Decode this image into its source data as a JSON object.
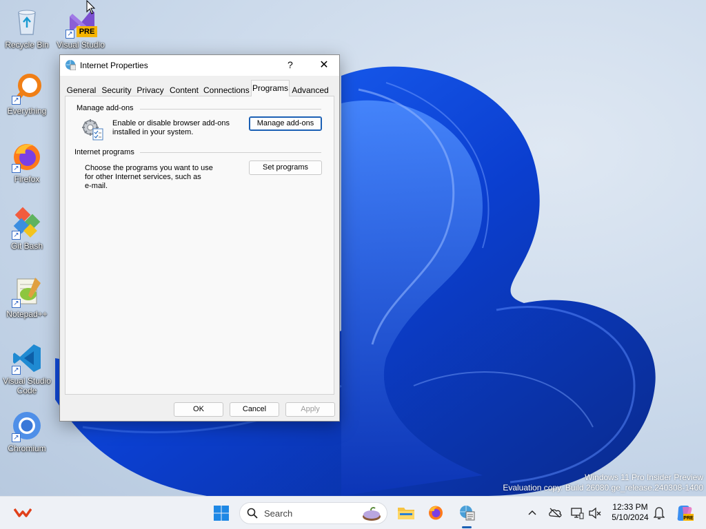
{
  "desktop": {
    "icons": [
      {
        "label": "Recycle Bin"
      },
      {
        "label": "Visual Studio",
        "badge": "PRE"
      },
      {
        "label": "Everything"
      },
      {
        "label": "Firefox"
      },
      {
        "label": "Git Bash"
      },
      {
        "label": "Notepad++"
      },
      {
        "label": "Visual Studio Code"
      },
      {
        "label": "Chromium"
      }
    ],
    "watermark": {
      "line1": "Windows 11 Pro Insider Preview",
      "line2": "Evaluation copy. Build 26080.ge_release.240308-1400"
    }
  },
  "dialog": {
    "title": "Internet Properties",
    "help": "?",
    "close": "✕",
    "tabs": [
      "General",
      "Security",
      "Privacy",
      "Content",
      "Connections",
      "Programs",
      "Advanced"
    ],
    "active_tab": "Programs",
    "addons": {
      "group_title": "Manage add-ons",
      "description_line1": "Enable or disable browser add-ons",
      "description_line2": "installed in your system.",
      "button": "Manage add-ons"
    },
    "programs": {
      "group_title": "Internet programs",
      "description_line1": "Choose the programs you want to use",
      "description_line2": "for other Internet services, such as",
      "description_line3": "e-mail.",
      "button": "Set programs"
    },
    "buttons": {
      "ok": "OK",
      "cancel": "Cancel",
      "apply": "Apply"
    }
  },
  "taskbar": {
    "search_placeholder": "Search",
    "clock_time": "12:33 PM",
    "clock_date": "5/10/2024",
    "icons": [
      "start-icon",
      "search-icon",
      "file-explorer-icon",
      "firefox-icon",
      "internet-properties-icon",
      "chevron-up-icon",
      "onedrive-icon",
      "display-icon",
      "volume-icon",
      "notification-bell-icon",
      "copilot-icon"
    ]
  }
}
